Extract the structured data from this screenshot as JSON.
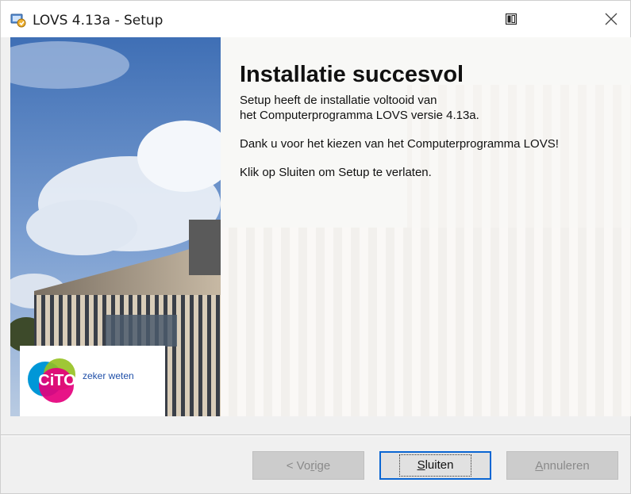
{
  "window": {
    "title": "LOVS 4.13a - Setup"
  },
  "hero": {
    "heading": "Installatie succesvol",
    "line1": "Setup heeft de installatie voltooid van",
    "line2": "het Computerprogramma LOVS versie 4.13a.",
    "thanks": "Dank u voor het kiezen van het Computerprogramma LOVS!",
    "close_hint": "Klik op Sluiten om Setup te verlaten."
  },
  "branding": {
    "logo_text": "CiTO",
    "tagline": "zeker weten",
    "logo_colors": [
      "#0097d7",
      "#e5007d",
      "#95c11f"
    ]
  },
  "buttons": {
    "back": {
      "label_access": "<",
      "prefix": "< Vo",
      "accel": "r",
      "suffix": "ige"
    },
    "finish": {
      "accel": "S",
      "suffix": "luiten"
    },
    "cancel": {
      "accel": "A",
      "suffix": "nnuleren"
    }
  },
  "colors": {
    "accent": "#0a66d3",
    "sky": "#5a86c4",
    "disabled_text": "#8a8a8a"
  }
}
